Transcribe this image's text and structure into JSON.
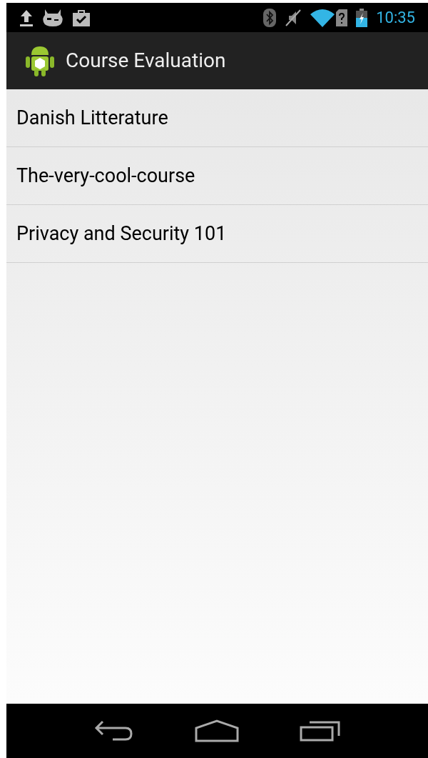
{
  "status_bar": {
    "time": "10:35"
  },
  "action_bar": {
    "title": "Course Evaluation"
  },
  "courses": [
    {
      "name": "Danish Litterature"
    },
    {
      "name": "The-very-cool-course"
    },
    {
      "name": "Privacy and Security 101"
    }
  ]
}
